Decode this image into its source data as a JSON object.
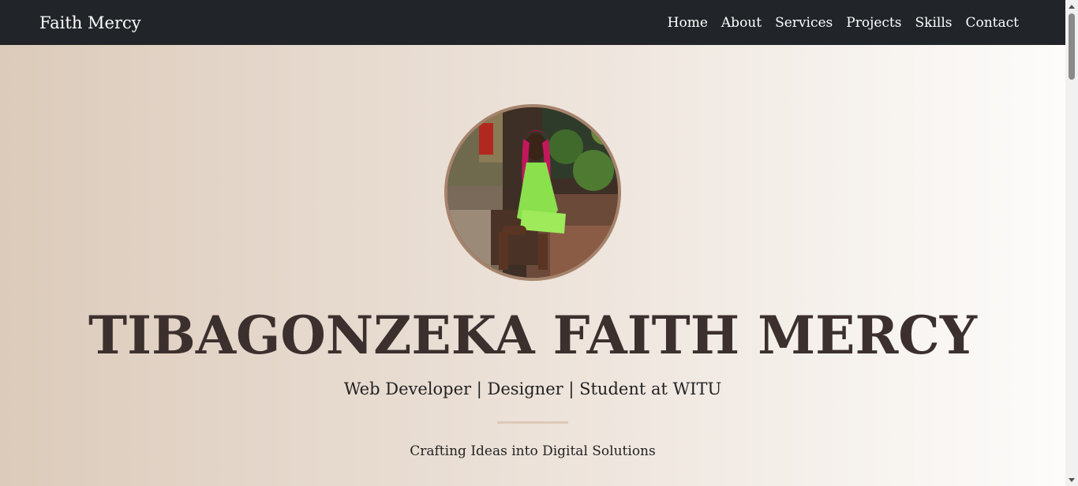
{
  "navbar": {
    "brand": "Faith Mercy",
    "links": [
      "Home",
      "About",
      "Services",
      "Projects",
      "Skills",
      "Contact"
    ]
  },
  "hero": {
    "avatar_icon": "profile-photo",
    "title": "TIBAGONZEKA FAITH MERCY",
    "subtitle": "Web Developer | Designer | Student at WITU",
    "tagline": "Crafting Ideas into Digital Solutions"
  },
  "colors": {
    "navbar_bg": "#212529",
    "title": "#3c302e",
    "avatar_border": "#a5836c",
    "hero_gradient_start": "#dccbbb",
    "hero_gradient_end": "#fdfcfb"
  }
}
